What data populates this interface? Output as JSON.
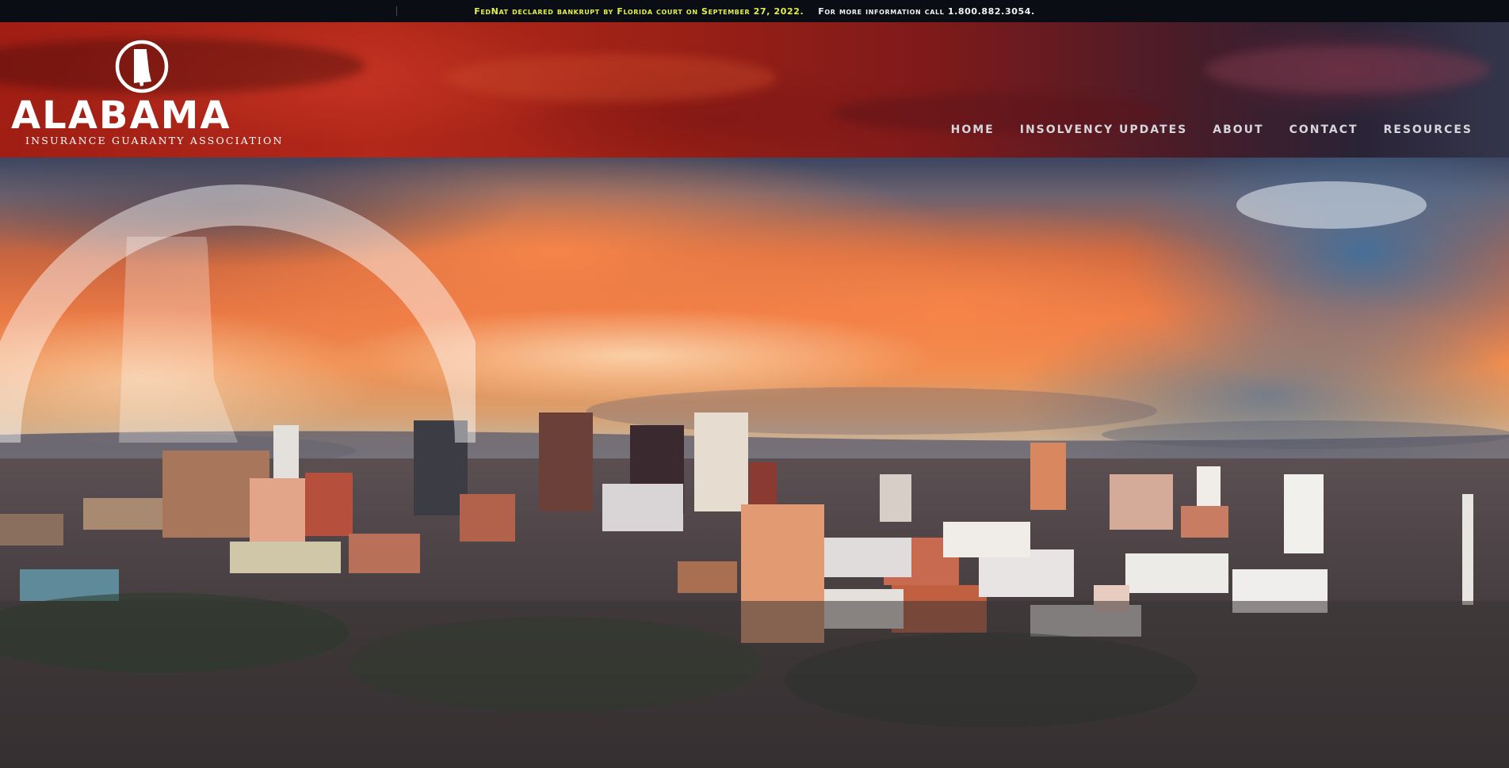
{
  "announcement": {
    "alert": "FedNat declared bankrupt by Florida court on September 27, 2022.",
    "info": "For more information call 1.800.882.3054."
  },
  "brand": {
    "name": "ALABAMA",
    "tagline": "INSURANCE GUARANTY ASSOCIATION",
    "logo_icon": "alabama-state-seal-icon"
  },
  "nav": {
    "items": [
      {
        "label": "HOME"
      },
      {
        "label": "INSOLVENCY UPDATES"
      },
      {
        "label": "ABOUT"
      },
      {
        "label": "CONTACT"
      },
      {
        "label": "RESOURCES"
      }
    ]
  },
  "colors": {
    "announcement_alert": "#e3f04a",
    "announcement_info": "#f2f2f2",
    "nav_text": "#d6d6dc",
    "header_red": "#a01e14"
  },
  "hero": {
    "image": "city-skyline-sunset-image"
  }
}
